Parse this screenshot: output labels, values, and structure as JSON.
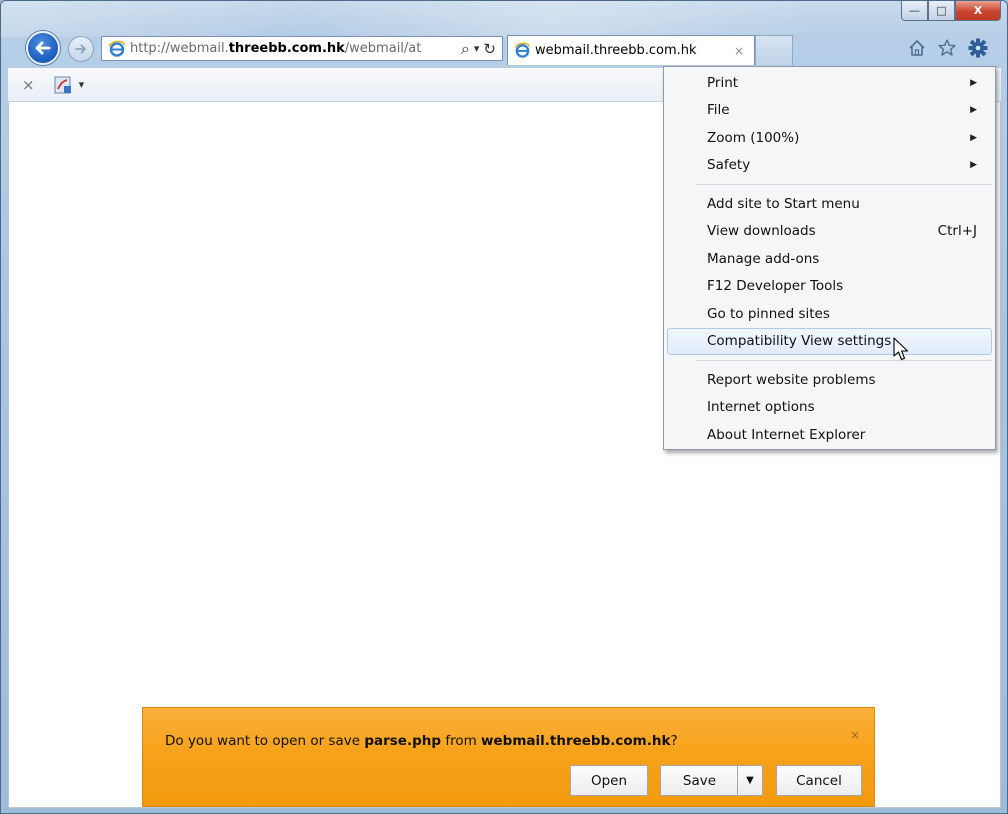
{
  "window": {
    "caption_buttons": {
      "minimize": "—",
      "maximize": "□",
      "close": "X"
    }
  },
  "nav": {
    "address_prefix": "http://webmail.",
    "address_domain": "threebb.com.hk",
    "address_suffix": "/webmail/at",
    "search_glyph": "⌕",
    "dropdown_glyph": "▾",
    "refresh_glyph": "↻"
  },
  "tab": {
    "title": "webmail.threebb.com.hk",
    "close": "×"
  },
  "addon_bar": {
    "close": "×",
    "dropdown": "▾"
  },
  "tools_menu": {
    "group1": [
      {
        "label": "Print",
        "submenu": true
      },
      {
        "label": "File",
        "submenu": true
      },
      {
        "label": "Zoom (100%)",
        "submenu": true
      },
      {
        "label": "Safety",
        "submenu": true
      }
    ],
    "group2": [
      {
        "label": "Add site to Start menu"
      },
      {
        "label": "View downloads",
        "accel": "Ctrl+J"
      },
      {
        "label": "Manage add-ons"
      },
      {
        "label": "F12 Developer Tools"
      },
      {
        "label": "Go to pinned sites"
      },
      {
        "label": "Compatibility View settings",
        "hovered": true
      }
    ],
    "group3": [
      {
        "label": "Report website problems"
      },
      {
        "label": "Internet options"
      },
      {
        "label": "About Internet Explorer"
      }
    ],
    "submenu_arrow": "▶"
  },
  "notification": {
    "prefix": "Do you want to open or save ",
    "filename": "parse.php",
    "middle": " from ",
    "site": "webmail.threebb.com.hk",
    "suffix": "?",
    "close": "×",
    "open_label": "Open",
    "save_label": "Save",
    "save_arrow": "▼",
    "cancel_label": "Cancel"
  },
  "colors": {
    "notification_bg": "#f7a21a",
    "menu_hover": "#e1ecf9",
    "back_button": "#1a5bbd"
  }
}
